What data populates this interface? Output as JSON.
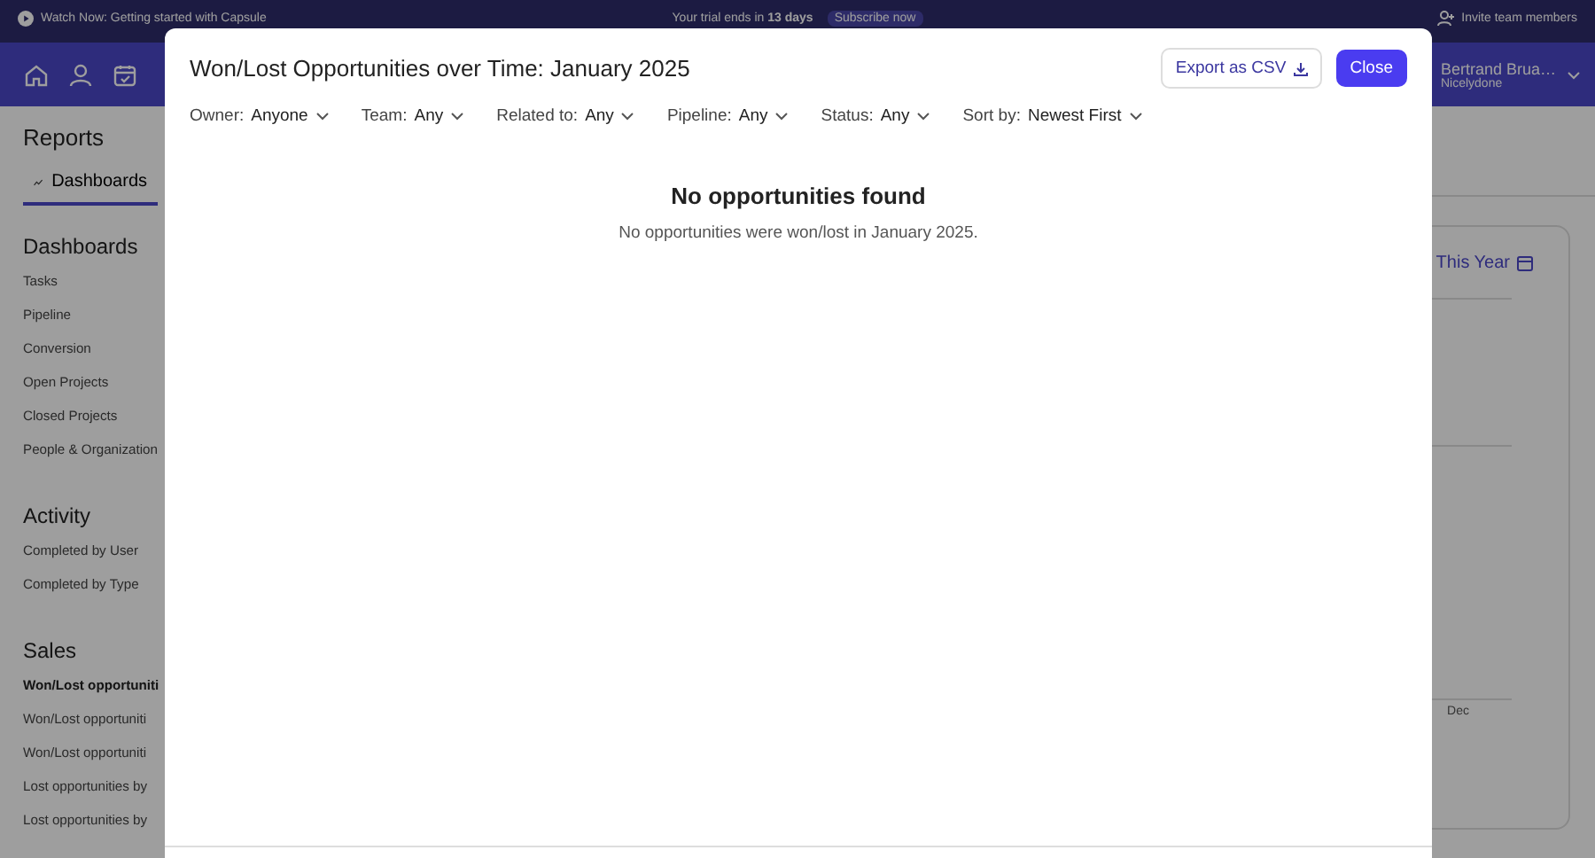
{
  "banner": {
    "video_link": "Watch Now: Getting started with Capsule",
    "trial_notice": "Your trial ends in **13 days**",
    "subscribe_button": "Subscribe now",
    "invite_link": "Invite team members"
  },
  "user": {
    "name": "Bertrand Brua…",
    "company": "Nicelydone"
  },
  "page": {
    "title": "Reports",
    "tabs": [
      {
        "label": "Dashboards",
        "selected": true
      }
    ]
  },
  "sidebar": {
    "sections": [
      {
        "title": "Dashboards",
        "items": [
          {
            "label": "Tasks",
            "selected": false
          },
          {
            "label": "Pipeline",
            "selected": false
          },
          {
            "label": "Conversion",
            "selected": false
          },
          {
            "label": "Open Projects",
            "selected": false
          },
          {
            "label": "Closed Projects",
            "selected": false
          },
          {
            "label": "People & Organization",
            "selected": false
          }
        ]
      },
      {
        "title": "Activity",
        "items": [
          {
            "label": "Completed by User",
            "selected": false
          },
          {
            "label": "Completed by Type",
            "selected": false
          }
        ]
      },
      {
        "title": "Sales",
        "items": [
          {
            "label": "Won/Lost opportuniti",
            "selected": true
          },
          {
            "label": "Won/Lost opportuniti",
            "selected": false
          },
          {
            "label": "Won/Lost opportuniti",
            "selected": false
          },
          {
            "label": "Lost opportunities by",
            "selected": false
          },
          {
            "label": "Lost opportunities by",
            "selected": false
          }
        ]
      }
    ]
  },
  "report_card": {
    "period_button": "This Year",
    "axis_label": "Dec"
  },
  "modal": {
    "title": "Won/Lost Opportunities over Time: January 2025",
    "export_button": "Export as CSV",
    "close_button": "Close",
    "filters": [
      {
        "label": "Owner:",
        "value": "Anyone"
      },
      {
        "label": "Team:",
        "value": "Any"
      },
      {
        "label": "Related to:",
        "value": "Any"
      },
      {
        "label": "Pipeline:",
        "value": "Any"
      },
      {
        "label": "Status:",
        "value": "Any"
      },
      {
        "label": "Sort by:",
        "value": "Newest First"
      }
    ],
    "empty_title": "No opportunities found",
    "empty_message": "No opportunities were won/lost in January 2025."
  }
}
